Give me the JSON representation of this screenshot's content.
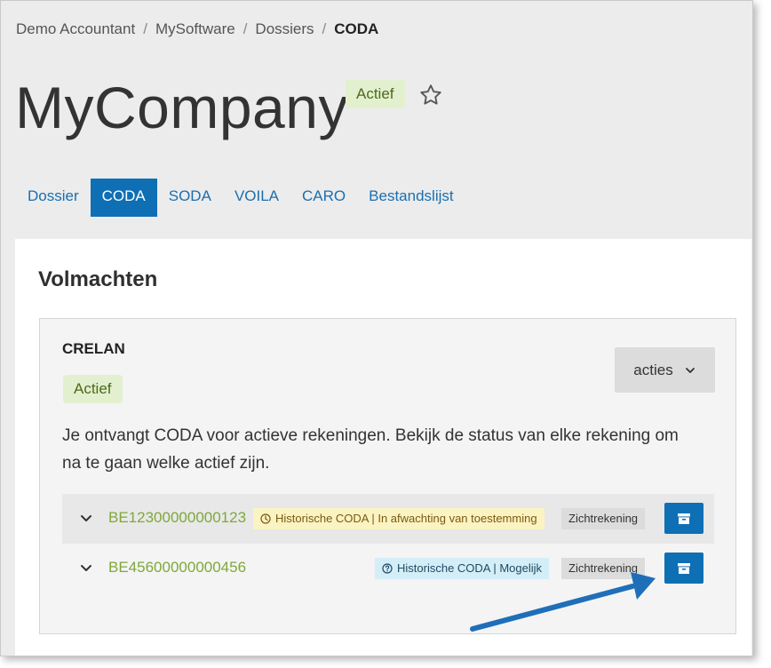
{
  "breadcrumb": {
    "items": [
      "Demo Accountant",
      "MySoftware",
      "Dossiers"
    ],
    "current": "CODA"
  },
  "page": {
    "title": "MyCompany",
    "status": "Actief"
  },
  "tabs": [
    {
      "label": "Dossier",
      "active": false
    },
    {
      "label": "CODA",
      "active": true
    },
    {
      "label": "SODA",
      "active": false
    },
    {
      "label": "VOILA",
      "active": false
    },
    {
      "label": "CARO",
      "active": false
    },
    {
      "label": "Bestandslijst",
      "active": false
    }
  ],
  "section": {
    "title": "Volmachten",
    "bank": {
      "name": "CRELAN",
      "status": "Actief",
      "actions_label": "acties",
      "description": "Je ontvangt CODA voor actieve rekeningen. Bekijk de status van elke rekening om na te gaan welke actief zijn.",
      "accounts": [
        {
          "iban": "BE12300000000123",
          "status": "Historische CODA | In afwachting van toestemming",
          "status_icon": "clock-icon",
          "type": "Zichtrekening"
        },
        {
          "iban": "BE45600000000456",
          "status": "Historische CODA | Mogelijk",
          "status_icon": "question-circle-icon",
          "type": "Zichtrekening"
        }
      ]
    }
  },
  "colors": {
    "primary": "#0f6fb5",
    "active_badge_bg": "#e3f0cf",
    "iban_green": "#7fa83a",
    "pending_bg": "#fbf3c2",
    "possible_bg": "#d4eef7",
    "annotation_arrow": "#1f6fb8"
  }
}
